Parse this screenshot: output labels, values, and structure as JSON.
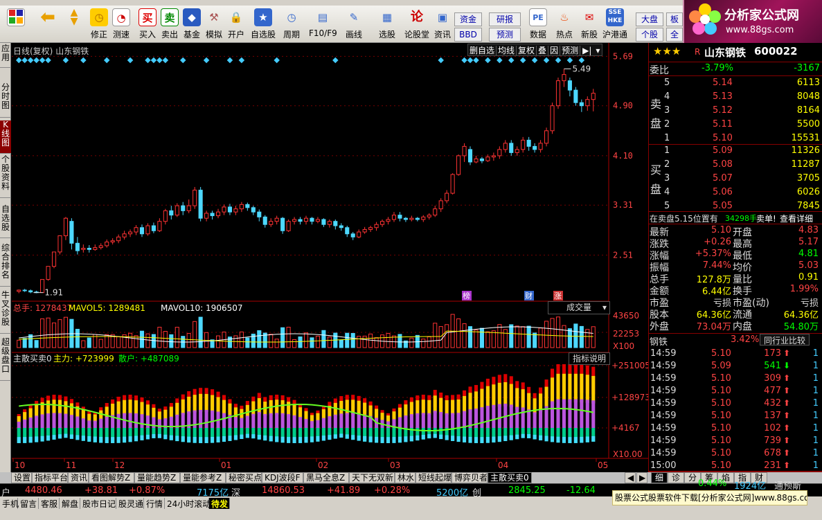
{
  "toolbar": {
    "items": [
      "修正",
      "测速",
      "买入",
      "卖出",
      "基金",
      "模拟",
      "开户",
      "自选股",
      "周期",
      "F10/F9",
      "画线",
      "选股",
      "论股堂",
      "资讯",
      "数据",
      "热点",
      "新股",
      "沪港通",
      "个股",
      "全"
    ],
    "top_buttons": [
      "资金",
      "研报",
      "BBD",
      "预测",
      "大盘",
      "板"
    ]
  },
  "logo": {
    "title": "分析家公式网",
    "url": "www.88gs.com"
  },
  "left_tabs": [
    "应用",
    "分时图",
    "K线图",
    "个股资料",
    "自选股",
    "综合排名",
    "牛叉诊股",
    "超级盘口"
  ],
  "chart_header": {
    "title": "日线(复权)",
    "stock": "山东钢铁",
    "buttons": [
      "删自选",
      "均线",
      "复权",
      "叠",
      "因",
      "预测"
    ]
  },
  "chart_data": {
    "type": "candlestick",
    "x_labels": [
      "10",
      "11",
      "12",
      "01",
      "02",
      "03",
      "04",
      "05"
    ],
    "price_ticks": [
      "5.69",
      "4.90",
      "4.10",
      "3.31",
      "2.51"
    ],
    "max_label": "5.49",
    "min_label": "1.91",
    "markers": [
      "榜",
      "财",
      "涨"
    ],
    "candles": [
      [
        1.93,
        1.95,
        1.9,
        1.96
      ],
      [
        1.95,
        1.94,
        1.92,
        1.97
      ],
      [
        1.94,
        1.92,
        1.9,
        1.96
      ],
      [
        1.92,
        1.91,
        1.9,
        1.94
      ],
      [
        1.91,
        2.12,
        1.91,
        2.12
      ],
      [
        2.12,
        2.33,
        2.1,
        2.33
      ],
      [
        2.33,
        2.56,
        2.3,
        2.56
      ],
      [
        2.56,
        2.82,
        2.52,
        2.82
      ],
      [
        2.82,
        3.1,
        2.75,
        3.12
      ],
      [
        3.05,
        2.7,
        2.6,
        3.1
      ],
      [
        2.7,
        2.58,
        2.52,
        2.8
      ],
      [
        2.6,
        2.62,
        2.55,
        2.68
      ],
      [
        2.62,
        2.6,
        2.55,
        2.67
      ],
      [
        2.6,
        2.63,
        2.58,
        2.68
      ],
      [
        2.63,
        2.66,
        2.6,
        2.7
      ],
      [
        2.66,
        2.72,
        2.63,
        2.76
      ],
      [
        2.72,
        2.74,
        2.68,
        2.78
      ],
      [
        2.74,
        2.8,
        2.7,
        2.84
      ],
      [
        2.8,
        2.85,
        2.76,
        2.9
      ],
      [
        2.85,
        2.88,
        2.8,
        2.92
      ],
      [
        2.88,
        2.95,
        2.83,
        2.99
      ],
      [
        2.95,
        2.85,
        2.8,
        3.0
      ],
      [
        2.85,
        2.98,
        2.82,
        3.02
      ],
      [
        2.98,
        2.9,
        2.86,
        3.03
      ],
      [
        2.9,
        3.05,
        2.88,
        3.1
      ],
      [
        3.05,
        3.22,
        3.0,
        3.25
      ],
      [
        3.22,
        3.15,
        3.08,
        3.3
      ],
      [
        3.15,
        3.3,
        3.12,
        3.34
      ],
      [
        3.3,
        3.22,
        3.15,
        3.36
      ],
      [
        3.22,
        3.3,
        3.18,
        3.4
      ],
      [
        3.3,
        3.55,
        3.25,
        3.6
      ],
      [
        3.55,
        3.1,
        3.05,
        3.6
      ],
      [
        3.1,
        3.18,
        3.05,
        3.22
      ],
      [
        3.18,
        3.14,
        3.08,
        3.22
      ],
      [
        3.14,
        3.2,
        3.1,
        3.25
      ],
      [
        3.2,
        3.28,
        3.15,
        3.32
      ],
      [
        3.28,
        3.2,
        3.15,
        3.33
      ],
      [
        3.2,
        3.25,
        3.15,
        3.3
      ],
      [
        3.25,
        3.32,
        3.2,
        3.36
      ],
      [
        3.32,
        3.27,
        3.22,
        3.35
      ],
      [
        3.27,
        3.2,
        3.15,
        3.3
      ],
      [
        3.2,
        3.12,
        3.05,
        3.24
      ],
      [
        3.12,
        3.0,
        2.95,
        3.15
      ],
      [
        3.0,
        3.05,
        2.96,
        3.1
      ],
      [
        3.05,
        3.1,
        3.0,
        3.14
      ],
      [
        3.1,
        2.9,
        2.85,
        3.12
      ],
      [
        2.9,
        3.05,
        2.88,
        3.08
      ],
      [
        3.05,
        3.08,
        3.0,
        3.12
      ],
      [
        3.08,
        3.05,
        3.0,
        3.12
      ],
      [
        3.05,
        3.1,
        3.0,
        3.14
      ],
      [
        3.1,
        3.05,
        3.0,
        3.12
      ],
      [
        3.05,
        3.08,
        3.02,
        3.12
      ],
      [
        3.08,
        3.0,
        2.96,
        3.1
      ],
      [
        3.0,
        3.05,
        2.95,
        3.08
      ],
      [
        3.05,
        2.98,
        2.92,
        3.08
      ],
      [
        2.98,
        2.95,
        2.9,
        3.02
      ],
      [
        2.95,
        2.85,
        2.8,
        2.98
      ],
      [
        2.85,
        2.8,
        2.75,
        2.88
      ],
      [
        2.8,
        2.88,
        2.78,
        2.92
      ],
      [
        2.88,
        2.92,
        2.85,
        2.96
      ],
      [
        2.92,
        2.95,
        2.88,
        2.98
      ],
      [
        2.95,
        3.0,
        2.9,
        3.04
      ],
      [
        3.0,
        3.05,
        2.96,
        3.08
      ],
      [
        3.05,
        3.08,
        3.0,
        3.12
      ],
      [
        3.08,
        3.15,
        3.04,
        3.2
      ],
      [
        3.15,
        3.1,
        3.05,
        3.2
      ],
      [
        3.1,
        3.08,
        3.04,
        3.12
      ],
      [
        3.08,
        3.1,
        3.05,
        3.14
      ],
      [
        3.1,
        3.08,
        3.05,
        3.12
      ],
      [
        3.08,
        3.12,
        3.04,
        3.15
      ],
      [
        3.12,
        3.15,
        3.08,
        3.18
      ],
      [
        3.15,
        3.25,
        3.12,
        3.3
      ],
      [
        3.25,
        3.38,
        3.2,
        3.42
      ],
      [
        3.38,
        3.5,
        3.34,
        3.55
      ],
      [
        3.5,
        3.8,
        3.48,
        3.82
      ],
      [
        3.8,
        4.1,
        3.78,
        4.12
      ],
      [
        4.1,
        4.25,
        4.0,
        4.3
      ],
      [
        4.2,
        4.0,
        3.95,
        4.25
      ],
      [
        4.0,
        4.05,
        3.98,
        4.1
      ],
      [
        4.05,
        4.02,
        3.98,
        4.08
      ],
      [
        4.02,
        4.08,
        4.0,
        4.12
      ],
      [
        4.08,
        4.1,
        4.02,
        4.15
      ],
      [
        4.1,
        4.2,
        4.05,
        4.25
      ],
      [
        4.2,
        4.3,
        4.15,
        4.35
      ],
      [
        4.3,
        4.15,
        4.1,
        4.35
      ],
      [
        4.15,
        4.2,
        4.1,
        4.25
      ],
      [
        4.2,
        4.35,
        4.15,
        4.4
      ],
      [
        4.35,
        4.25,
        4.18,
        4.4
      ],
      [
        4.25,
        4.2,
        4.15,
        4.3
      ],
      [
        4.2,
        4.3,
        4.15,
        4.35
      ],
      [
        4.3,
        4.5,
        4.25,
        4.55
      ],
      [
        4.5,
        4.9,
        4.45,
        4.95
      ],
      [
        4.9,
        5.3,
        4.85,
        5.35
      ],
      [
        5.3,
        5.4,
        5.2,
        5.49
      ],
      [
        5.3,
        5.15,
        5.05,
        5.35
      ],
      [
        5.15,
        4.95,
        4.9,
        5.2
      ],
      [
        4.95,
        4.9,
        4.8,
        5.0
      ],
      [
        4.9,
        5.0,
        4.82,
        5.05
      ],
      [
        5.0,
        5.1,
        4.81,
        5.17
      ]
    ],
    "vol_ticks": [
      "43650",
      "22253",
      "X100"
    ],
    "vol_legend": [
      "总手: 1278437",
      "MAVOL5: 1289481",
      "MAVOL10: 1906507"
    ],
    "ind_ticks": [
      "+251005",
      "+128973",
      "+4167",
      "X10.00"
    ],
    "ind_legend": [
      "主散买卖0",
      "主力: +723999",
      "散户: +487089"
    ]
  },
  "vol_selector": "成交量",
  "ind_explain": "指标说明",
  "quote": {
    "stars": "★★★",
    "r": "R",
    "name": "山东钢铁",
    "code": "600022",
    "weibi_label": "委比",
    "weibi_pct": "-3.79%",
    "weibi_val": "-3167",
    "sell_label": [
      "卖",
      "盘"
    ],
    "buy_label": [
      "买",
      "盘"
    ],
    "sells": [
      [
        "5",
        "5.14",
        "6113"
      ],
      [
        "4",
        "5.13",
        "8048"
      ],
      [
        "3",
        "5.12",
        "8164"
      ],
      [
        "2",
        "5.11",
        "5500"
      ],
      [
        "1",
        "5.10",
        "15531"
      ]
    ],
    "buys": [
      [
        "1",
        "5.09",
        "11326"
      ],
      [
        "2",
        "5.08",
        "11287"
      ],
      [
        "3",
        "5.07",
        "3705"
      ],
      [
        "4",
        "5.06",
        "6026"
      ],
      [
        "5",
        "5.05",
        "7845"
      ]
    ],
    "note": [
      "在卖盘5.15位置有",
      "34298手",
      "卖单!",
      "查看详细"
    ],
    "stats": [
      [
        "最新",
        "5.10",
        "开盘",
        "4.83"
      ],
      [
        "涨跌",
        "+0.26",
        "最高",
        "5.17"
      ],
      [
        "涨幅",
        "+5.37%",
        "最低",
        "4.81"
      ],
      [
        "振幅",
        "7.44%",
        "均价",
        "5.03"
      ],
      [
        "总手",
        "127.8万",
        "量比",
        "0.91"
      ],
      [
        "金额",
        "6.44亿",
        "换手",
        "1.99%"
      ],
      [
        "市盈",
        "亏损",
        "市盈(动)",
        "亏损"
      ],
      [
        "股本",
        "64.36亿",
        "流通",
        "64.36亿"
      ],
      [
        "外盘",
        "73.04万",
        "内盘",
        "54.80万"
      ]
    ],
    "industry": "钢铁",
    "industry_pct": "3.42%",
    "compare_btn": "同行业比较",
    "ticks": [
      [
        "14:59",
        "5.10",
        "173",
        "1"
      ],
      [
        "14:59",
        "5.09",
        "541",
        "1"
      ],
      [
        "14:59",
        "5.10",
        "309",
        "1"
      ],
      [
        "14:59",
        "5.10",
        "477",
        "1"
      ],
      [
        "14:59",
        "5.10",
        "432",
        "1"
      ],
      [
        "14:59",
        "5.10",
        "137",
        "1"
      ],
      [
        "14:59",
        "5.10",
        "102",
        "1"
      ],
      [
        "14:59",
        "5.10",
        "739",
        "1"
      ],
      [
        "14:59",
        "5.10",
        "678",
        "1"
      ],
      [
        "15:00",
        "5.10",
        "231",
        "1"
      ]
    ],
    "tabs": [
      "细",
      "诊",
      "分",
      "筹",
      "焰",
      "指",
      "财"
    ]
  },
  "bottom_tabs": [
    "设置",
    "指标平台",
    "资讯",
    "看图解势Z",
    "量能趋势Z",
    "量能参考Z",
    "秘密买点",
    "KDJ波段F",
    "黑马全息Z",
    "天下无双新",
    "林水",
    "短线起爆",
    "博弈贝者",
    "主散买卖0"
  ],
  "index_bar": [
    "户",
    "4480.46",
    "+38.81",
    "+0.87%",
    "7175亿",
    "深",
    "14860.53",
    "+41.89",
    "+0.28%",
    "5200亿",
    "创",
    "2845.25",
    "-12.64",
    "0.44%",
    "1924亿",
    "通预斯"
  ],
  "status_items": [
    "手机",
    "留言",
    "客服",
    "解盘",
    "股市日记",
    "股灵通",
    "行情",
    "24小时滚动",
    "待发"
  ],
  "banner": "股票公式股票软件下载[分析家公式网]www.88gs.com"
}
